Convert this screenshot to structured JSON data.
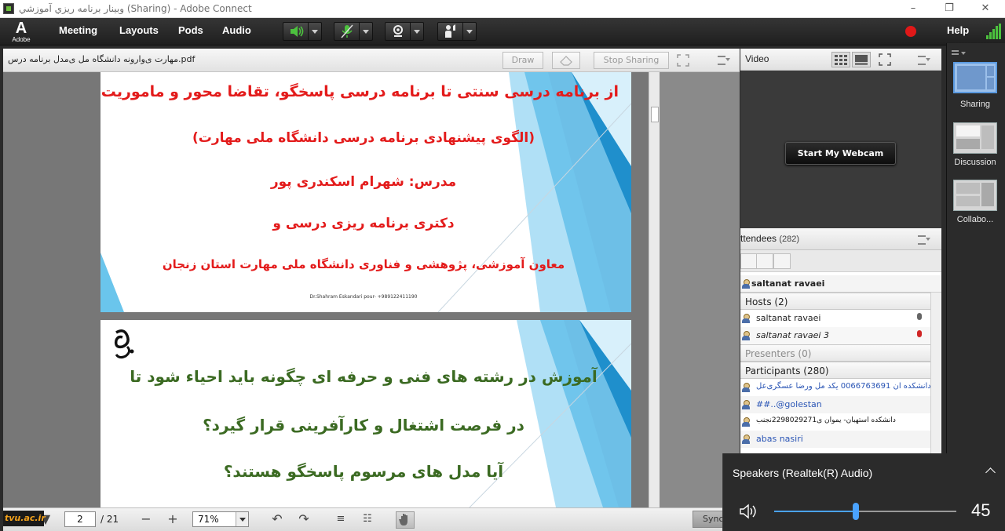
{
  "window": {
    "title": "وبينار برنامه ريزي آموزشي (Sharing) - Adobe Connect",
    "controls": [
      "minimize",
      "restore",
      "close"
    ]
  },
  "menubar": {
    "logo_text": "Adobe",
    "items": [
      "Meeting",
      "Layouts",
      "Pods",
      "Audio"
    ],
    "help": "Help",
    "icons": [
      "speaker-icon",
      "microphone-muted-icon",
      "webcam-icon",
      "raise-hand-icon"
    ],
    "colors": {
      "active_green": "#4cc23e",
      "record_red": "#e01818"
    }
  },
  "share_pod": {
    "file_name": "مهارت ی‌وارونه دانشگاه مل ی‌مدل برنامه درس.pdf",
    "draw_label": "Draw",
    "stop_sharing_label": "Stop Sharing",
    "slide1": {
      "lines": [
        "از برنامه درسی سنتی تا برنامه درسی پاسخگو، تقاضا محور و ماموریت گرا",
        "(الگوی پیشنهادی برنامه درسی دانشگاه ملی مهارت)",
        "مدرس: شهرام اسکندری پور",
        "دکتری برنامه ریزی درسی و",
        "معاون آموزشی، پژوهشی و فناوری دانشگاه ملی مهارت استان زنجان"
      ],
      "footer": "Dr.Shahram Eskandari pour- +989122411190"
    },
    "slide2": {
      "lines": [
        "آموزش در رشته های فنی و حرفه ای چگونه باید احیاء شود تا",
        "در فرصت اشتغال و کارآفرینی قرار گیرد؟",
        "آیا مدل های مرسوم پاسخگو هستند؟"
      ]
    },
    "bottom": {
      "page_value": "2",
      "page_total": "/ 21",
      "zoom_value": "71%",
      "sync_label": "Sync",
      "watermark": "tvu.ac.ir"
    }
  },
  "video_pod": {
    "title": "Video",
    "start_webcam_label": "Start My Webcam"
  },
  "attendees_pod": {
    "title": "ttendees",
    "count": "(282)",
    "current_user": "saltanat ravaei",
    "groups": [
      {
        "label": "Hosts (2)",
        "members": [
          "saltanat ravaei",
          "saltanat ravaei 3"
        ]
      },
      {
        "label": "Presenters (0)",
        "members": []
      },
      {
        "label": "Participants (280)",
        "members": [
          "دانشکده ان 0066763691 یکد مل ورضا عسگری‌عل...",
          "##..@golestan",
          "دانشکده استهبان- یموان ی2298029271نجنب",
          "abas nasiri"
        ]
      }
    ]
  },
  "layouts_bar": {
    "items": [
      "Sharing",
      "Discussion",
      "Collabo..."
    ]
  },
  "volume_flyout": {
    "device": "Speakers (Realtek(R) Audio)",
    "level": 45,
    "level_fraction": 0.45
  }
}
